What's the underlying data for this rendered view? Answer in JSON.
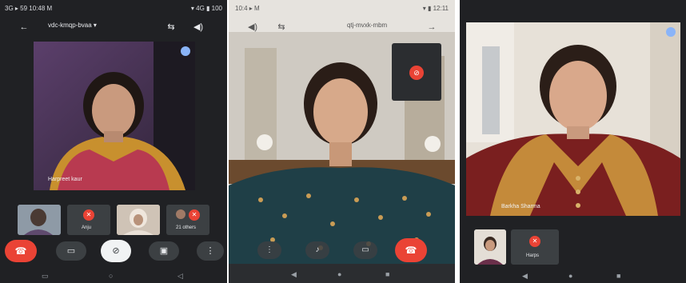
{
  "colors": {
    "end_call_red": "#ea4335",
    "dark_bg": "#202124",
    "control_bg": "#3c4043"
  },
  "phone1": {
    "status_left": "3G ▸ 59 10:48 M",
    "status_right": "▾ 4G ▮ 100",
    "meeting_title": "vdc-kmqp-bvaa ▾",
    "main_participant_name": "Harpreet kaur",
    "thumbnails": [
      {
        "label": ""
      },
      {
        "label": "Anju"
      },
      {
        "label": ""
      },
      {
        "label": "21 others"
      }
    ],
    "icons": [
      "back-arrow-icon",
      "switch-camera-icon",
      "speaker-icon",
      "end-call-icon",
      "camera-icon",
      "mic-off-icon",
      "present-icon",
      "more-icon"
    ]
  },
  "phone2": {
    "status_left": "10:4 ▸ M",
    "status_right": "▾ ▮ 12:11",
    "meeting_title": "qtj-mvxk-mbm",
    "icons": [
      "speaker-icon",
      "switch-camera-icon",
      "more-icon",
      "mic-icon",
      "caption-icon",
      "end-call-icon"
    ]
  },
  "phone3": {
    "main_participant_name": "Barkha Sharma",
    "thumbnail_label": "Harps",
    "icons": [
      "pin-icon",
      "mic-off-icon"
    ]
  }
}
